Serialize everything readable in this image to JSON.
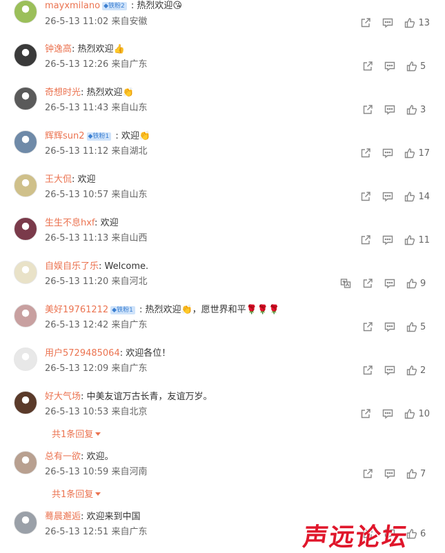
{
  "comments": [
    {
      "user": "mayxmilano",
      "badge": "铁粉2",
      "text": "热烈欢迎😘",
      "date": "26-5-13 11:02",
      "location": "来自安徽",
      "likes": "13",
      "avatar_color": "#9bbf5a"
    },
    {
      "user": "钟逸高",
      "badge": "",
      "text": "热烈欢迎👍",
      "date": "26-5-13 12:26",
      "location": "来自广东",
      "likes": "5",
      "avatar_color": "#3a3a3a"
    },
    {
      "user": "奇想时光",
      "badge": "",
      "text": "热烈欢迎👏",
      "date": "26-5-13 11:43",
      "location": "来自山东",
      "likes": "3",
      "avatar_color": "#5a5a5a"
    },
    {
      "user": "辉辉sun2",
      "badge": "铁粉1",
      "text": "欢迎👏",
      "date": "26-5-13 11:12",
      "location": "来自湖北",
      "likes": "17",
      "avatar_color": "#6f8aa8"
    },
    {
      "user": "王大侃",
      "badge": "",
      "text": "欢迎",
      "date": "26-5-13 10:57",
      "location": "来自山东",
      "likes": "14",
      "avatar_color": "#cfc08a"
    },
    {
      "user": "生生不息hxf",
      "badge": "",
      "text": "欢迎",
      "date": "26-5-13 11:13",
      "location": "来自山西",
      "likes": "11",
      "avatar_color": "#7a3a4a"
    },
    {
      "user": "自娱自乐了乐",
      "badge": "",
      "text": "Welcome.",
      "date": "26-5-13 11:20",
      "location": "来自河北",
      "likes": "9",
      "avatar_color": "#e9e2c8",
      "translate": true
    },
    {
      "user": "美好19761212",
      "badge": "铁粉1",
      "text": "热烈欢迎👏，愿世界和平🌹🌹🌹",
      "date": "26-5-13 12:42",
      "location": "来自广东",
      "likes": "5",
      "avatar_color": "#c8a0a0"
    },
    {
      "user": "用户5729485064",
      "badge": "",
      "text": "欢迎各位！",
      "date": "26-5-13 12:09",
      "location": "来自广东",
      "likes": "2",
      "avatar_color": "#e8e8e8"
    },
    {
      "user": "好大气场",
      "badge": "",
      "text": "中美友谊万古长青，友谊万岁。",
      "date": "26-5-13 10:53",
      "location": "来自北京",
      "likes": "10",
      "avatar_color": "#5a3a2a",
      "replies": "共1条回复"
    },
    {
      "user": "总有一欲",
      "badge": "",
      "text": "欢迎。",
      "date": "26-5-13 10:59",
      "location": "来自河南",
      "likes": "7",
      "avatar_color": "#b8a090",
      "replies": "共1条回复"
    },
    {
      "user": "蓦晨邂逅",
      "badge": "",
      "text": "欢迎来到中国",
      "date": "26-5-13 12:51",
      "location": "来自广东",
      "likes": "6",
      "avatar_color": "#9aa0a8"
    }
  ],
  "watermark": "声远论坛",
  "colors": {
    "username": "#eb7350",
    "text": "#333333",
    "meta": "#666666",
    "icon": "#888888",
    "badge_bg": "#cfe3fa",
    "badge_fg": "#3b7fd1"
  },
  "icons": {
    "share": "share-icon",
    "comment": "comment-icon",
    "like": "thumbs-up-icon",
    "translate": "translate-icon"
  }
}
